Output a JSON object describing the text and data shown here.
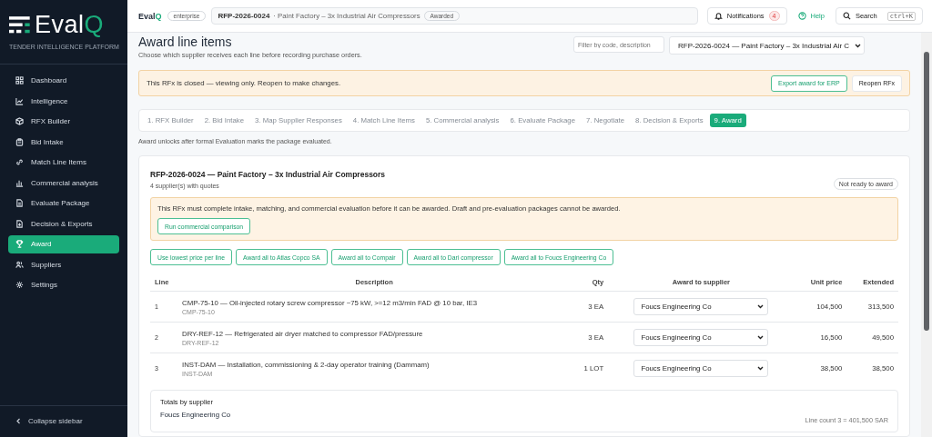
{
  "sidebar": {
    "logo": {
      "text": "Eval",
      "accent": "Q"
    },
    "tagline": "TENDER INTELLIGENCE PLATFORM",
    "items": [
      {
        "label": "Dashboard",
        "selected": false
      },
      {
        "label": "Intelligence",
        "selected": false
      },
      {
        "label": "RFX Builder",
        "selected": false
      },
      {
        "label": "Bid Intake",
        "selected": false
      },
      {
        "label": "Match Line Items",
        "selected": false
      },
      {
        "label": "Commercial analysis",
        "selected": false
      },
      {
        "label": "Evaluate Package",
        "selected": false
      },
      {
        "label": "Decision & Exports",
        "selected": false
      },
      {
        "label": "Award",
        "selected": true
      },
      {
        "label": "Suppliers",
        "selected": false
      },
      {
        "label": "Settings",
        "selected": false
      }
    ],
    "collapse": "Collapse sidebar"
  },
  "topbar": {
    "brand": {
      "text": "Eval",
      "accent": "Q"
    },
    "plan": "enterprise",
    "breadcrumb": {
      "code": "RFP-2026-0024",
      "title": "· Paint Factory – 3x Industrial Air Compressors",
      "status": "Awarded"
    },
    "notifications": {
      "label": "Notifications",
      "count": "4"
    },
    "help": "Help",
    "search": {
      "label": "Search",
      "shortcut": "ctrl+K"
    }
  },
  "page": {
    "title": "Award line items",
    "subtitle": "Choose which supplier receives each line before recording purchase orders.",
    "filter": {
      "placeholder": "Filter by code, description"
    },
    "rfx_select": "RFP-2026-0024 — Paint Factory – 3x Industrial Air C",
    "banner": {
      "text": "This RFx is closed — viewing only. Reopen to make changes.",
      "buttons": [
        {
          "label": "Export award for ERP",
          "kind": "outline"
        },
        {
          "label": "Reopen RFx",
          "kind": "plain"
        }
      ]
    },
    "steps": [
      {
        "label": "1. RFX Builder",
        "selected": false
      },
      {
        "label": "2. Bid Intake",
        "selected": false
      },
      {
        "label": "3. Map Supplier Responses",
        "selected": false
      },
      {
        "label": "4. Match Line Items",
        "selected": false
      },
      {
        "label": "5. Commercial analysis",
        "selected": false
      },
      {
        "label": "6. Evaluate Package",
        "selected": false
      },
      {
        "label": "7. Negotiate",
        "selected": false
      },
      {
        "label": "8. Decision & Exports",
        "selected": false
      },
      {
        "label": "9. Award",
        "selected": true
      }
    ],
    "note": "Award unlocks after formal Evaluation marks the package evaluated."
  },
  "card": {
    "title": "RFP-2026-0024 — Paint Factory – 3x Industrial Air Compressors",
    "subtitle": "4 supplier(s) with quotes",
    "status": "Not ready to award",
    "warning": {
      "text": "This RFx must complete intake, matching, and commercial evaluation before it can be awarded. Draft and pre-evaluation packages cannot be awarded.",
      "button": "Run commercial comparison"
    },
    "bulk_buttons": [
      "Use lowest price per line",
      "Award all to Atlas Copco SA",
      "Award all to Compair",
      "Award all to Dari compressor",
      "Award all to Foucs Engineering Co"
    ],
    "table": {
      "columns": [
        "Line",
        "Description",
        "Qty",
        "Award to supplier",
        "Unit price",
        "Extended"
      ],
      "rows": [
        {
          "line": "1",
          "description": "CMP-75-10 — Oil-injected rotary screw compressor ~75 kW, >=12 m3/min FAD @ 10 bar, IE3",
          "code": "CMP-75-10",
          "qty": "3 EA",
          "supplier": "Foucs Engineering Co",
          "unit_price": "104,500",
          "extended": "313,500"
        },
        {
          "line": "2",
          "description": "DRY-REF-12 — Refrigerated air dryer matched to compressor FAD/pressure",
          "code": "DRY-REF-12",
          "qty": "3 EA",
          "supplier": "Foucs Engineering Co",
          "unit_price": "16,500",
          "extended": "49,500"
        },
        {
          "line": "3",
          "description": "INST-DAM — Installation, commissioning & 2-day operator training (Dammam)",
          "code": "INST-DAM",
          "qty": "1 LOT",
          "supplier": "Foucs Engineering Co",
          "unit_price": "38,500",
          "extended": "38,500"
        }
      ]
    },
    "totals": {
      "title": "Totals by supplier",
      "supplier": "Foucs Engineering Co",
      "summary": "Line count 3 = 401,500 SAR"
    }
  }
}
